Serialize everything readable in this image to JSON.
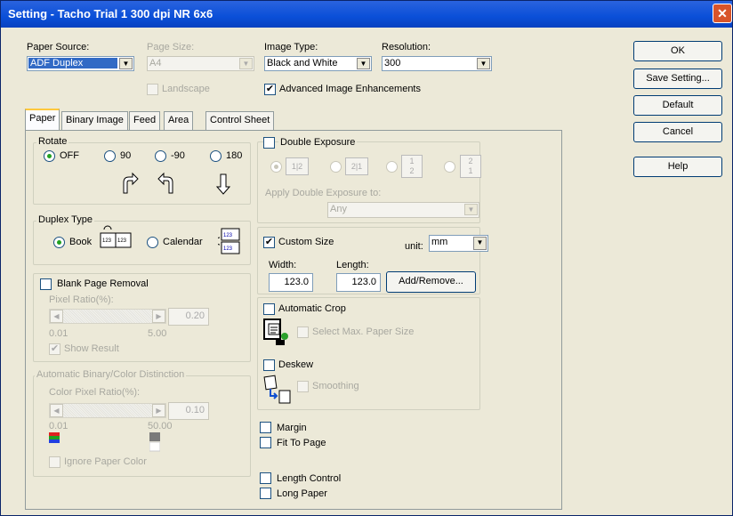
{
  "window": {
    "title": "Setting - Tacho Trial 1 300 dpi NR 6x6",
    "close_glyph": "✕"
  },
  "top": {
    "paper_source": {
      "label": "Paper Source:",
      "value": "ADF Duplex"
    },
    "page_size": {
      "label": "Page Size:",
      "value": "A4"
    },
    "landscape": {
      "label": "Landscape",
      "checked": false
    },
    "image_type": {
      "label": "Image Type:",
      "value": "Black and White"
    },
    "resolution": {
      "label": "Resolution:",
      "value": "300"
    },
    "advanced": {
      "label": "Advanced Image Enhancements",
      "checked": true
    }
  },
  "buttons": {
    "ok": "OK",
    "save": "Save Setting...",
    "default": "Default",
    "cancel": "Cancel",
    "help": "Help"
  },
  "tabs": [
    "Paper",
    "Binary Image",
    "Feed",
    "Area",
    "Control Sheet"
  ],
  "rotate": {
    "title": "Rotate",
    "options": [
      "OFF",
      "90",
      "-90",
      "180"
    ],
    "selected": "OFF",
    "icons": [
      "rotate-right-arrow-icon",
      "rotate-left-arrow-icon",
      "down-arrow-icon"
    ]
  },
  "duplex": {
    "title": "Duplex Type",
    "book": "Book",
    "calendar": "Calendar",
    "selected": "Book"
  },
  "blank_page": {
    "label": "Blank Page Removal",
    "ratio_label": "Pixel Ratio(%):",
    "value": "0.20",
    "min": "0.01",
    "max": "5.00",
    "show_result": "Show Result"
  },
  "auto_binary": {
    "title": "Automatic Binary/Color Distinction",
    "ratio_label": "Color Pixel Ratio(%):",
    "value": "0.10",
    "min": "0.01",
    "max": "50.00",
    "ignore": "Ignore Paper Color"
  },
  "double_exposure": {
    "label": "Double Exposure",
    "apply_label": "Apply Double Exposure to:",
    "apply_value": "Any",
    "option_glyphs": [
      [
        "1",
        "2"
      ],
      [
        "2",
        "1"
      ],
      [
        "1",
        "2"
      ],
      [
        "2",
        "1"
      ]
    ]
  },
  "custom_size": {
    "label": "Custom Size",
    "checked": true,
    "unit_label": "unit:",
    "unit_value": "mm",
    "width_label": "Width:",
    "width_value": "123.0",
    "length_label": "Length:",
    "length_value": "123.0",
    "add_remove": "Add/Remove..."
  },
  "auto_crop": {
    "label": "Automatic Crop",
    "select_max": "Select Max. Paper Size"
  },
  "deskew": {
    "label": "Deskew",
    "smoothing": "Smoothing"
  },
  "options": {
    "margin": "Margin",
    "fit_to_page": "Fit To Page",
    "length_control": "Length Control",
    "long_paper": "Long Paper"
  }
}
